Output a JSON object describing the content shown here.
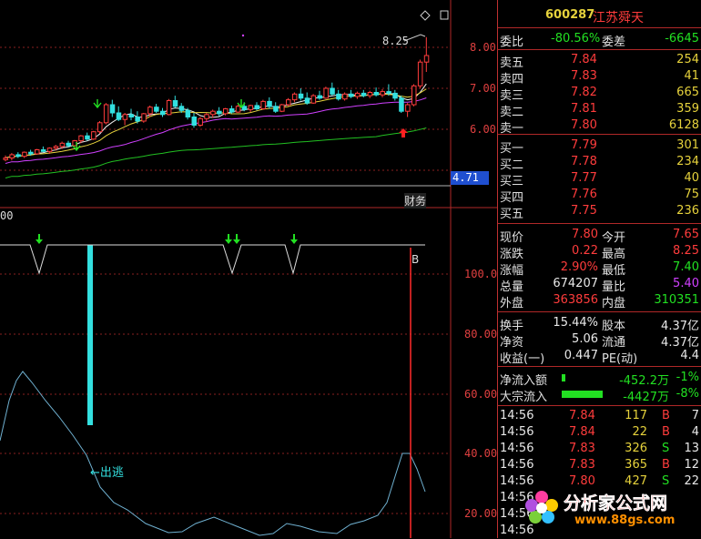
{
  "stock": {
    "code": "600287",
    "name": "江苏舜天"
  },
  "toolbar": {
    "diamond_icon": "diamond-icon",
    "box_icon": "square-icon"
  },
  "main_chart": {
    "price_axis": [
      "8.00",
      "7.00",
      "6.00"
    ],
    "current_marker": "4.71",
    "high_label": "8.25",
    "tab_label": "财务",
    "candles": [
      [
        5.26,
        5.36,
        5.22,
        5.3
      ],
      [
        5.3,
        5.42,
        5.24,
        5.38
      ],
      [
        5.38,
        5.44,
        5.3,
        5.34
      ],
      [
        5.34,
        5.46,
        5.3,
        5.44
      ],
      [
        5.44,
        5.5,
        5.36,
        5.4
      ],
      [
        5.4,
        5.52,
        5.38,
        5.5
      ],
      [
        5.5,
        5.58,
        5.44,
        5.46
      ],
      [
        5.46,
        5.56,
        5.4,
        5.54
      ],
      [
        5.54,
        5.62,
        5.48,
        5.58
      ],
      [
        5.58,
        5.7,
        5.52,
        5.66
      ],
      [
        5.66,
        5.72,
        5.56,
        5.6
      ],
      [
        5.6,
        5.74,
        5.58,
        5.72
      ],
      [
        5.72,
        5.86,
        5.66,
        5.84
      ],
      [
        5.84,
        5.92,
        5.72,
        5.76
      ],
      [
        5.76,
        5.96,
        5.74,
        5.94
      ],
      [
        5.94,
        6.2,
        5.9,
        6.16
      ],
      [
        6.16,
        6.64,
        6.12,
        6.6
      ],
      [
        6.6,
        6.72,
        6.3,
        6.4
      ],
      [
        6.4,
        6.56,
        6.2,
        6.24
      ],
      [
        6.24,
        6.4,
        6.1,
        6.36
      ],
      [
        6.36,
        6.5,
        6.22,
        6.3
      ],
      [
        6.3,
        6.44,
        6.14,
        6.2
      ],
      [
        6.2,
        6.4,
        6.16,
        6.38
      ],
      [
        6.38,
        6.58,
        6.3,
        6.54
      ],
      [
        6.54,
        6.62,
        6.4,
        6.44
      ],
      [
        6.44,
        6.52,
        6.3,
        6.36
      ],
      [
        6.36,
        6.74,
        6.34,
        6.7
      ],
      [
        6.7,
        6.82,
        6.52,
        6.56
      ],
      [
        6.56,
        6.64,
        6.4,
        6.46
      ],
      [
        6.46,
        6.52,
        6.24,
        6.3
      ],
      [
        6.3,
        6.4,
        6.04,
        6.1
      ],
      [
        6.1,
        6.3,
        6.06,
        6.26
      ],
      [
        6.26,
        6.4,
        6.18,
        6.36
      ],
      [
        6.36,
        6.48,
        6.28,
        6.44
      ],
      [
        6.44,
        6.54,
        6.32,
        6.38
      ],
      [
        6.38,
        6.52,
        6.34,
        6.5
      ],
      [
        6.5,
        6.58,
        6.38,
        6.42
      ],
      [
        6.42,
        6.6,
        6.4,
        6.56
      ],
      [
        6.56,
        6.66,
        6.44,
        6.48
      ],
      [
        6.48,
        6.6,
        6.42,
        6.58
      ],
      [
        6.58,
        6.66,
        6.46,
        6.5
      ],
      [
        6.5,
        6.72,
        6.48,
        6.68
      ],
      [
        6.68,
        6.78,
        6.5,
        6.56
      ],
      [
        6.56,
        6.66,
        6.4,
        6.44
      ],
      [
        6.44,
        6.62,
        6.42,
        6.6
      ],
      [
        6.6,
        6.76,
        6.56,
        6.72
      ],
      [
        6.72,
        6.9,
        6.66,
        6.86
      ],
      [
        6.86,
        7.0,
        6.7,
        6.76
      ],
      [
        6.76,
        6.9,
        6.6,
        6.64
      ],
      [
        6.64,
        6.86,
        6.62,
        6.82
      ],
      [
        6.82,
        6.94,
        6.72,
        6.76
      ],
      [
        6.76,
        7.04,
        6.74,
        7.0
      ],
      [
        7.0,
        7.14,
        6.82,
        6.86
      ],
      [
        6.86,
        6.96,
        6.7,
        6.74
      ],
      [
        6.74,
        6.9,
        6.7,
        6.86
      ],
      [
        6.86,
        6.96,
        6.76,
        6.8
      ],
      [
        6.8,
        6.92,
        6.74,
        6.88
      ],
      [
        6.88,
        6.96,
        6.78,
        6.82
      ],
      [
        6.82,
        6.94,
        6.76,
        6.9
      ],
      [
        6.9,
        7.02,
        6.8,
        6.84
      ],
      [
        6.84,
        6.98,
        6.78,
        6.92
      ],
      [
        6.92,
        7.1,
        6.82,
        6.88
      ],
      [
        6.88,
        6.96,
        6.7,
        6.76
      ],
      [
        6.76,
        6.82,
        6.4,
        6.44
      ],
      [
        6.44,
        6.64,
        6.3,
        6.6
      ],
      [
        6.6,
        7.1,
        6.56,
        7.06
      ],
      [
        7.06,
        7.7,
        7.0,
        7.64
      ],
      [
        7.64,
        8.25,
        7.4,
        7.8
      ]
    ]
  },
  "indicator_chart": {
    "y_axis": [
      "100.0",
      "80.00",
      "60.00",
      "40.00",
      "20.00"
    ],
    "left_label": "00",
    "signal_label": "←出逃",
    "b_label": "B"
  },
  "quote": {
    "weibi_label": "委比",
    "weibi": "-80.56%",
    "weicha_label": "委差",
    "weicha": "-6645",
    "asks": [
      {
        "label": "卖五",
        "price": "7.84",
        "vol": "254"
      },
      {
        "label": "卖四",
        "price": "7.83",
        "vol": "41"
      },
      {
        "label": "卖三",
        "price": "7.82",
        "vol": "665"
      },
      {
        "label": "卖二",
        "price": "7.81",
        "vol": "359"
      },
      {
        "label": "卖一",
        "price": "7.80",
        "vol": "6128"
      }
    ],
    "bids": [
      {
        "label": "买一",
        "price": "7.79",
        "vol": "301"
      },
      {
        "label": "买二",
        "price": "7.78",
        "vol": "234"
      },
      {
        "label": "买三",
        "price": "7.77",
        "vol": "40"
      },
      {
        "label": "买四",
        "price": "7.76",
        "vol": "75"
      },
      {
        "label": "买五",
        "price": "7.75",
        "vol": "236"
      }
    ],
    "stats": [
      {
        "l1": "现价",
        "v1": "7.80",
        "c1": "red",
        "l2": "今开",
        "v2": "7.65",
        "c2": "red"
      },
      {
        "l1": "涨跌",
        "v1": "0.22",
        "c1": "red",
        "l2": "最高",
        "v2": "8.25",
        "c2": "red"
      },
      {
        "l1": "涨幅",
        "v1": "2.90%",
        "c1": "red",
        "l2": "最低",
        "v2": "7.40",
        "c2": "green"
      },
      {
        "l1": "总量",
        "v1": "674207",
        "c1": "white",
        "l2": "量比",
        "v2": "5.40",
        "c2": "purple"
      },
      {
        "l1": "外盘",
        "v1": "363856",
        "c1": "red",
        "l2": "内盘",
        "v2": "310351",
        "c2": "green"
      }
    ],
    "fund": [
      {
        "l1": "换手",
        "v1": "15.44%",
        "l2": "股本",
        "v2": "4.37亿"
      },
      {
        "l1": "净资",
        "v1": "5.06",
        "l2": "流通",
        "v2": "4.37亿"
      },
      {
        "l1": "收益(一)",
        "v1": "0.447",
        "l2": "PE(动)",
        "v2": "4.4"
      }
    ],
    "flows": [
      {
        "label": "净流入额",
        "value": "-452.2万",
        "pct": "-1%",
        "bar": 0.05
      },
      {
        "label": "大宗流入",
        "value": "-4427万",
        "pct": "-8%",
        "bar": 0.6
      }
    ],
    "trades": [
      {
        "time": "14:56",
        "price": "7.84",
        "vol": "117",
        "side": "B",
        "n": "7"
      },
      {
        "time": "14:56",
        "price": "7.84",
        "vol": "22",
        "side": "B",
        "n": "4"
      },
      {
        "time": "14:56",
        "price": "7.83",
        "vol": "326",
        "side": "S",
        "n": "13"
      },
      {
        "time": "14:56",
        "price": "7.83",
        "vol": "365",
        "side": "B",
        "n": "12"
      },
      {
        "time": "14:56",
        "price": "7.80",
        "vol": "427",
        "side": "S",
        "n": "22"
      },
      {
        "time": "14:56",
        "price": "",
        "vol": "",
        "side": "",
        "n": ""
      },
      {
        "time": "14:56",
        "price": "",
        "vol": "",
        "side": "",
        "n": ""
      },
      {
        "time": "14:56",
        "price": "",
        "vol": "",
        "side": "",
        "n": ""
      }
    ]
  },
  "watermark": {
    "text": "分析家公式网",
    "url": "www.88gs.com"
  }
}
